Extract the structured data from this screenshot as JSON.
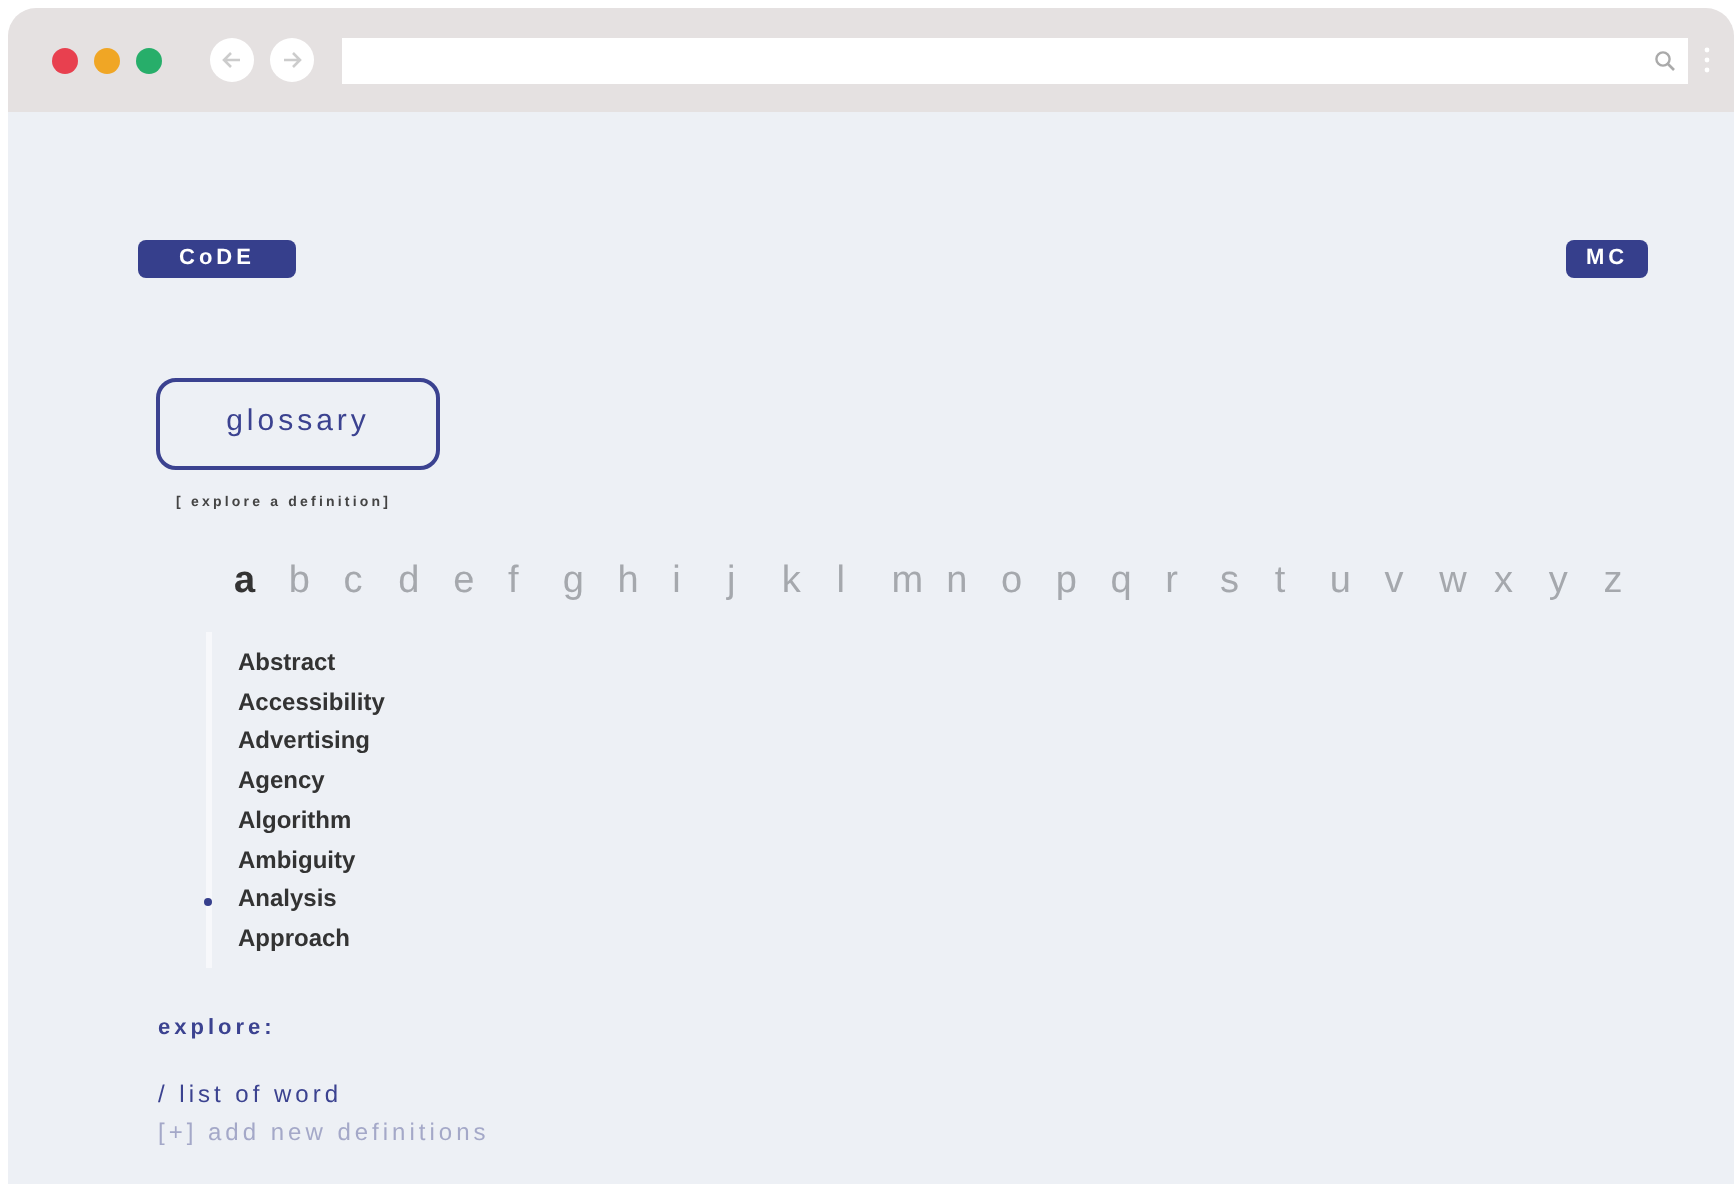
{
  "browser": {
    "window_controls": [
      {
        "color": "#e8404f"
      },
      {
        "color": "#f0a625"
      },
      {
        "color": "#27ae6a"
      }
    ]
  },
  "header": {
    "logo": "CoDE",
    "user": "MC"
  },
  "glossary": {
    "title": "glossary",
    "subtitle": "[ explore a definition]"
  },
  "letters": [
    {
      "label": "a",
      "selected": true
    },
    {
      "label": "b",
      "selected": false
    },
    {
      "label": "c",
      "selected": false
    },
    {
      "label": "d",
      "selected": false
    },
    {
      "label": "e",
      "selected": false
    },
    {
      "label": "f",
      "selected": false
    },
    {
      "label": "g",
      "selected": false
    },
    {
      "label": "h",
      "selected": false
    },
    {
      "label": "i",
      "selected": false
    },
    {
      "label": "j",
      "selected": false
    },
    {
      "label": "k",
      "selected": false
    },
    {
      "label": "l",
      "selected": false
    },
    {
      "label": "m",
      "selected": false
    },
    {
      "label": "n",
      "selected": false
    },
    {
      "label": "o",
      "selected": false
    },
    {
      "label": "p",
      "selected": false
    },
    {
      "label": "q",
      "selected": false
    },
    {
      "label": "r",
      "selected": false
    },
    {
      "label": "s",
      "selected": false
    },
    {
      "label": "t",
      "selected": false
    },
    {
      "label": "u",
      "selected": false
    },
    {
      "label": "v",
      "selected": false
    },
    {
      "label": "w",
      "selected": false
    },
    {
      "label": "x",
      "selected": false
    },
    {
      "label": "y",
      "selected": false
    },
    {
      "label": "z",
      "selected": false
    }
  ],
  "words": [
    {
      "label": "Abstract",
      "selected": false
    },
    {
      "label": "Accessibility",
      "selected": false
    },
    {
      "label": "Advertising",
      "selected": false
    },
    {
      "label": "Agency",
      "selected": false
    },
    {
      "label": "Algorithm",
      "selected": false
    },
    {
      "label": "Ambiguity",
      "selected": false
    },
    {
      "label": "Analysis",
      "selected": true
    },
    {
      "label": "Approach",
      "selected": false
    }
  ],
  "explore": {
    "heading": "explore:",
    "links": [
      {
        "label": "/ list of word",
        "kind": "primary"
      },
      {
        "label": "[+] add new definitions",
        "kind": "muted"
      }
    ]
  }
}
